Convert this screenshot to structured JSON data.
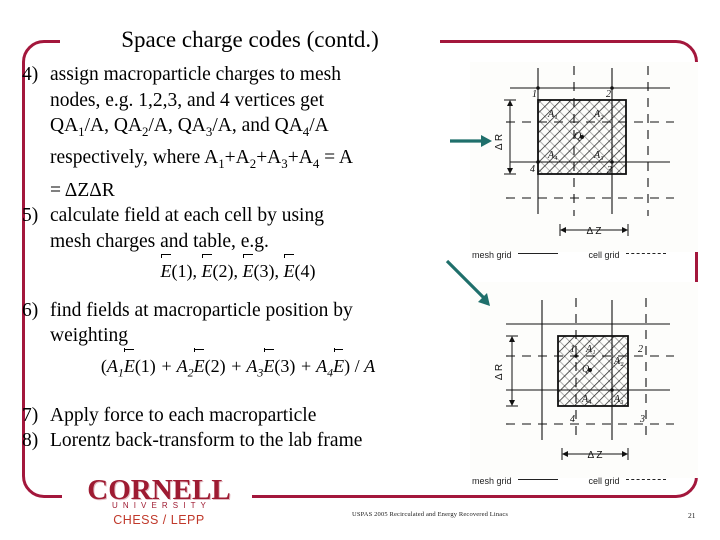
{
  "slide": {
    "title": "Space charge codes (contd.)",
    "accent_color": "#A3173C",
    "logo_color": "#9E1B32",
    "arrow_color": "#1F6F6B"
  },
  "body": {
    "items": [
      {
        "number": "4)",
        "lines": [
          "assign macroparticle charges to mesh",
          "nodes, e.g. 1,2,3, and 4 vertices get",
          "QA<sub>1</sub>/A, QA<sub>2</sub>/A, QA<sub>3</sub>/A, and QA<sub>4</sub>/A",
          "respectively, where A<sub>1</sub>+A<sub>2</sub>+A<sub>3</sub>+A<sub>4</sub> = A",
          "= &Delta;Z&Delta;R"
        ]
      },
      {
        "number": "5)",
        "lines": [
          "calculate field at each cell by using",
          "mesh charges and table, e.g."
        ]
      },
      {
        "number": "6)",
        "lines": [
          "find fields at macroparticle position by",
          "weighting"
        ]
      },
      {
        "number": "7)",
        "lines": [
          "Apply force to each macroparticle"
        ]
      },
      {
        "number": "8)",
        "lines": [
          "Lorentz back-transform to the lab frame"
        ]
      }
    ],
    "equation_fields": "E(1), E(2), E(3), E(4)",
    "equation_weighting": "(A1E(1) + A2E(2) + A3E(3) + A4E) / A"
  },
  "figures": {
    "top": {
      "name": "mesh-cell-diagram-node-centered",
      "node_labels": [
        "1",
        "2",
        "3",
        "4"
      ],
      "area_labels": [
        "A1",
        "A2",
        "A3",
        "A4"
      ],
      "charge_label": "Q",
      "dim_vertical": "Δ R",
      "dim_horizontal": "Δ Z",
      "legend": [
        {
          "label": "mesh  grid",
          "style": "solid"
        },
        {
          "label": "cell  grid",
          "style": "dashed"
        }
      ]
    },
    "bottom": {
      "name": "mesh-cell-diagram-cell-centered",
      "node_labels": [
        "1",
        "2",
        "3",
        "4"
      ],
      "area_labels": [
        "A1",
        "A2",
        "A3",
        "A4"
      ],
      "charge_label": "Q",
      "dim_vertical": "Δ R",
      "dim_horizontal": "Δ Z",
      "legend": [
        {
          "label": "mesh  grid",
          "style": "solid"
        },
        {
          "label": "cell  grid",
          "style": "dashed"
        }
      ]
    }
  },
  "logo": {
    "word": "CORNELL",
    "sub": "UNIVERSITY",
    "unit": "CHESS / LEPP"
  },
  "footer": {
    "text": "USPAS 2005 Recirculated and Energy Recovered Linacs",
    "page": "21"
  }
}
